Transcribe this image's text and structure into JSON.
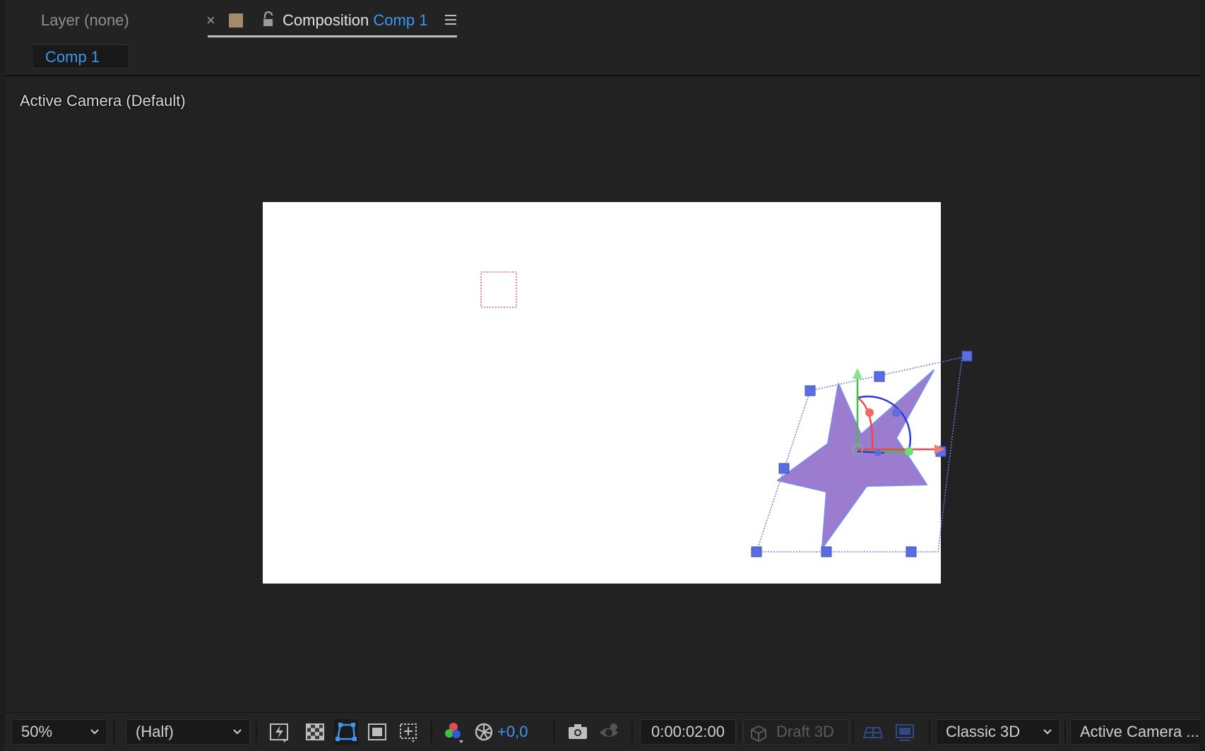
{
  "tabs": {
    "layer_tab_label": "Layer (none)",
    "close_symbol": "×",
    "composition_prefix": "Composition",
    "composition_name": "Comp 1"
  },
  "breadcrumb": {
    "label": "Comp 1"
  },
  "viewer": {
    "camera_label": "Active Camera (Default)"
  },
  "toolbar": {
    "zoom": "50%",
    "resolution": "(Half)",
    "exposure": "+0,0",
    "timecode": "0:00:02:00",
    "draft3d": "Draft 3D",
    "renderer": "Classic 3D",
    "view": "Active Camera ..."
  },
  "colors": {
    "accent": "#3d95f4",
    "label_swatch": "#a38a6a",
    "star_fill": "#9b7cce",
    "handle": "#5b6ee0",
    "axis_x": "#e84a4a",
    "axis_y": "#3ec23e",
    "axis_z": "#2d3ad8"
  },
  "icons": {
    "lock": "lock-open-icon",
    "menu": "hamburger-menu-icon",
    "fast_previews": "fast-previews-icon",
    "transparency_grid": "transparency-grid-icon",
    "mask_path": "mask-path-visibility-icon",
    "region_of_interest": "region-of-interest-icon",
    "grid_guides": "grid-guides-icon",
    "channels": "rgb-channels-icon",
    "color_management": "color-management-icon",
    "snapshot": "camera-snapshot-icon",
    "show_snapshot": "show-snapshot-icon",
    "draft3d": "draft-3d-cube-icon",
    "ground_plane": "ground-plane-icon",
    "extended_viewer": "extended-viewer-icon"
  }
}
